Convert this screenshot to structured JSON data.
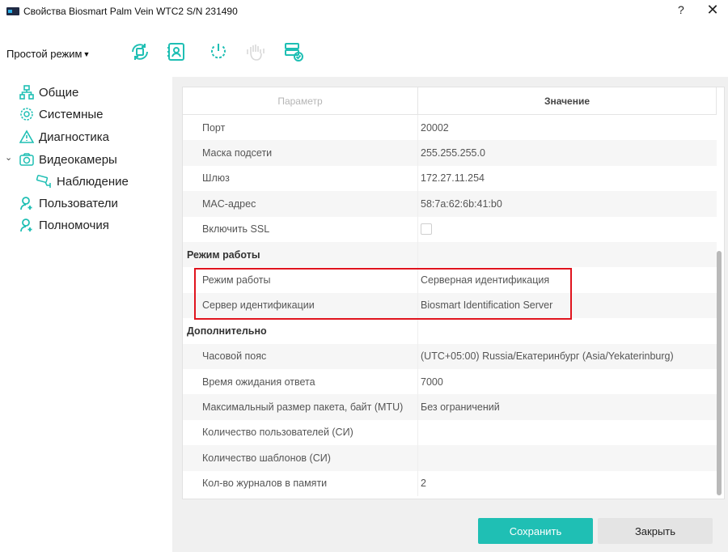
{
  "window": {
    "title": "Свойства Biosmart Palm Vein WTC2 S/N 231490",
    "help": "?",
    "close": "✕"
  },
  "toolbar": {
    "mode_label": "Простой режим",
    "mode_caret": "▼",
    "icons": [
      "sync-icon",
      "user-scan-icon",
      "power-icon",
      "palm-icon",
      "server-check-icon"
    ]
  },
  "sidebar": {
    "items": [
      {
        "label": "Общие",
        "icon": "network-icon"
      },
      {
        "label": "Системные",
        "icon": "gear-icon"
      },
      {
        "label": "Диагностика",
        "icon": "warning-icon"
      },
      {
        "label": "Видеокамеры",
        "icon": "camera-icon",
        "expanded": true
      },
      {
        "label": "Наблюдение",
        "icon": "cctv-icon"
      },
      {
        "label": "Пользователи",
        "icon": "user-add-icon"
      },
      {
        "label": "Полномочия",
        "icon": "user-add-icon"
      }
    ],
    "expand_arrow": "⌄"
  },
  "table": {
    "header_param": "Параметр",
    "header_value": "Значение",
    "rows": [
      {
        "key": "Порт",
        "value": "20002"
      },
      {
        "key": "Маска подсети",
        "value": "255.255.255.0"
      },
      {
        "key": "Шлюз",
        "value": "172.27.11.254"
      },
      {
        "key": "MAC-адрес",
        "value": "58:7a:62:6b:41:b0"
      },
      {
        "key": "Включить SSL",
        "value": ""
      },
      {
        "key": "Режим работы",
        "value": ""
      },
      {
        "key": "Режим работы",
        "value": "Серверная идентификация"
      },
      {
        "key": "Сервер идентификации",
        "value": "Biosmart Identification Server"
      },
      {
        "key": "Дополнительно",
        "value": ""
      },
      {
        "key": "Часовой пояс",
        "value": "(UTC+05:00) Russia/Екатеринбург (Asia/Yekaterinburg)"
      },
      {
        "key": "Время ожидания ответа",
        "value": "7000"
      },
      {
        "key": "Максимальный размер пакета, байт (MTU)",
        "value": "Без ограничений"
      },
      {
        "key": "Количество пользователей (СИ)",
        "value": ""
      },
      {
        "key": "Количество шаблонов (СИ)",
        "value": ""
      },
      {
        "key": "Кол-во журналов в памяти",
        "value": "2"
      }
    ]
  },
  "buttons": {
    "save": "Сохранить",
    "close": "Закрыть"
  },
  "colors": {
    "accent": "#1fbfb4",
    "highlight": "#e0141e"
  }
}
